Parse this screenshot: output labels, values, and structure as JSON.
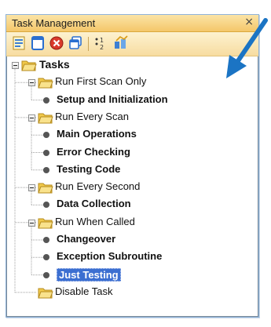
{
  "window": {
    "title": "Task Management",
    "close_glyph": "×"
  },
  "toolbar": {
    "buttons": [
      {
        "name": "properties-icon"
      },
      {
        "name": "new-icon"
      },
      {
        "name": "delete-icon"
      },
      {
        "name": "copy-icon"
      },
      {
        "name": "sort-icon"
      },
      {
        "name": "compile-icon"
      }
    ],
    "sort_label": "1\n2"
  },
  "tree": {
    "root": "Tasks",
    "groups": [
      {
        "label": "Run First Scan Only",
        "children": [
          "Setup and Initialization"
        ]
      },
      {
        "label": "Run Every Scan",
        "children": [
          "Main Operations",
          "Error Checking",
          "Testing Code"
        ]
      },
      {
        "label": "Run Every Second",
        "children": [
          "Data Collection"
        ]
      },
      {
        "label": "Run When Called",
        "children": [
          "Changeover",
          "Exception Subroutine",
          "Just Testing"
        ]
      },
      {
        "label": "Disable Task",
        "children": []
      }
    ],
    "selected": "Just Testing"
  },
  "colors": {
    "selection": "#3c6fd1",
    "arrow": "#1b74c4",
    "title_bar": "#f4c76a"
  }
}
